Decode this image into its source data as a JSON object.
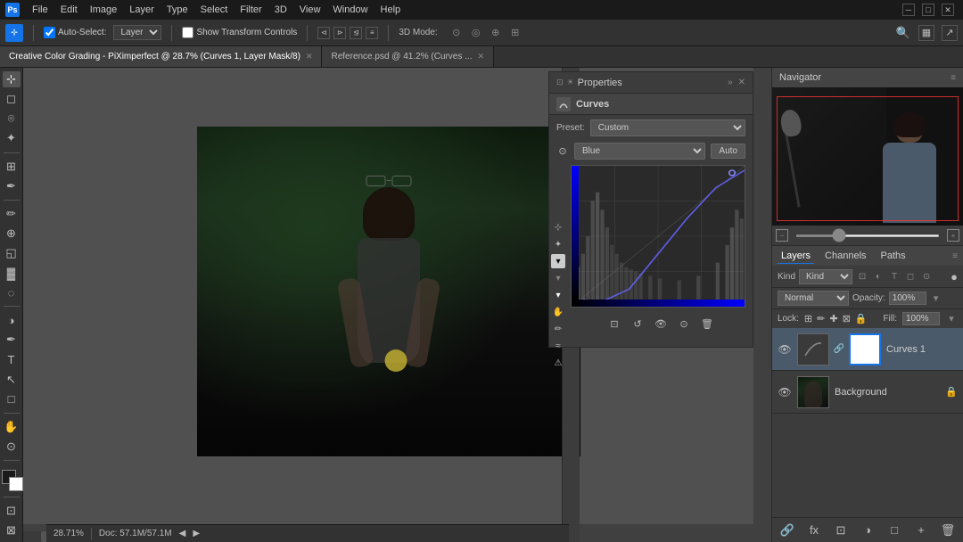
{
  "app": {
    "title": "Adobe Photoshop",
    "icon_label": "Ps"
  },
  "menu": {
    "items": [
      "File",
      "Edit",
      "Image",
      "Layer",
      "Type",
      "Select",
      "Filter",
      "3D",
      "View",
      "Window",
      "Help"
    ]
  },
  "toolbar": {
    "auto_select_label": "Auto-Select:",
    "auto_select_value": "Layer",
    "show_transform_label": "Show Transform Controls",
    "mode_3d_label": "3D Mode:"
  },
  "tabs": [
    {
      "id": "tab1",
      "label": "Creative Color Grading - PiXimperfect @ 28.7% (Curves 1, Layer Mask/8)",
      "active": true
    },
    {
      "id": "tab2",
      "label": "Reference.psd @ 41.2% (Curves ...",
      "active": false
    }
  ],
  "properties": {
    "header": "Properties",
    "curves_label": "Curves",
    "preset_label": "Preset:",
    "preset_value": "Custom",
    "channel_value": "Blue",
    "auto_label": "Auto",
    "expand_icon": "»",
    "close_icon": "✕"
  },
  "navigator": {
    "title": "Navigator",
    "zoom": "28.71%"
  },
  "layers": {
    "title": "Layers",
    "channels_label": "Channels",
    "paths_label": "Paths",
    "kind_label": "Kind",
    "blend_mode": "Normal",
    "opacity_label": "Opacity:",
    "opacity_value": "100%",
    "lock_label": "Lock:",
    "fill_label": "Fill:",
    "fill_value": "100%",
    "items": [
      {
        "id": "layer1",
        "name": "Curves 1",
        "visible": true,
        "selected": true,
        "has_mask": true
      },
      {
        "id": "layer2",
        "name": "Background",
        "visible": true,
        "selected": false,
        "has_mask": false,
        "locked": true
      }
    ]
  },
  "status": {
    "zoom": "28.71%",
    "doc_info": "Doc: 57.1M/57.1M"
  },
  "tools": {
    "items": [
      "⊹",
      "◻",
      "✂",
      "⟲",
      "✒",
      "✏",
      "A",
      "T",
      "↖",
      "⊙"
    ],
    "colors": {
      "fg": "#000000",
      "bg": "#ffffff"
    }
  }
}
